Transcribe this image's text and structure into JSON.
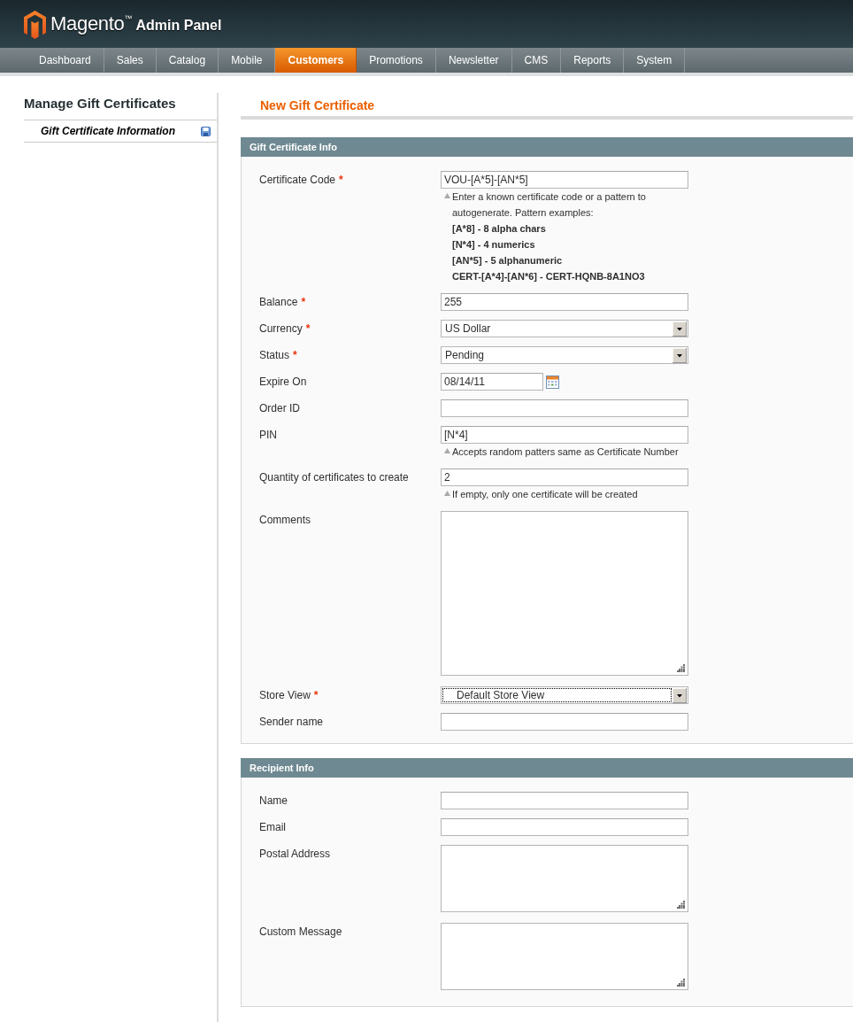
{
  "header": {
    "logo_text": "Magento$^{™}$",
    "logo_subtitle": "Admin Panel"
  },
  "nav": {
    "tabs": [
      {
        "label": "Dashboard",
        "selected": false
      },
      {
        "label": "Sales",
        "selected": false
      },
      {
        "label": "Catalog",
        "selected": false
      },
      {
        "label": "Mobile",
        "selected": false
      },
      {
        "label": "Customers",
        "selected": true
      },
      {
        "label": "Promotions",
        "selected": false
      },
      {
        "label": "Newsletter",
        "selected": false
      },
      {
        "label": "CMS",
        "selected": false
      },
      {
        "label": "Reports",
        "selected": false
      },
      {
        "label": "System",
        "selected": false
      }
    ]
  },
  "sidebar": {
    "title": "Manage Gift Certificates",
    "items": [
      {
        "label": "Gift Certificate Information",
        "selected": true
      }
    ]
  },
  "page_title": "New Gift Certificate",
  "sections": [
    {
      "title": "Gift Certificate Info",
      "fields": [
        {
          "label": "Certificate Code",
          "required_mark": "*",
          "kind": "text",
          "value": "VOU-[A*5]-[AN*5]",
          "focused": false,
          "note": {
            "text": "Enter a known certificate code or a pattern to autogenerate. Pattern examples:",
            "examples": [
              "[A*8] - 8 alpha chars",
              "[N*4] - 4 numerics",
              "[AN*5] - 5 alphanumeric",
              "CERT-[A*4]-[AN*6] - CERT-HQNB-8A1NO3"
            ]
          }
        },
        {
          "label": "Balance",
          "required_mark": "*",
          "kind": "text",
          "value": "255",
          "focused": false
        },
        {
          "label": "Currency",
          "required_mark": "*",
          "kind": "select",
          "value": "US Dollar",
          "indented": false,
          "focused": false
        },
        {
          "label": "Status",
          "required_mark": "*",
          "kind": "select",
          "value": "Pending",
          "indented": false,
          "focused": false
        },
        {
          "label": "Expire On",
          "kind": "date",
          "value": "08/14/11",
          "focused": false
        },
        {
          "label": "Order ID",
          "kind": "text",
          "focused": false
        },
        {
          "label": "PIN",
          "kind": "text",
          "value": "[N*4]",
          "focused": false,
          "note": {
            "text": "Accepts random patters same as Certificate Number"
          }
        },
        {
          "label": "Quantity of certificates to create",
          "kind": "text",
          "value": "2",
          "focused": false,
          "note": {
            "text": "If empty, only one certificate will be created"
          }
        },
        {
          "label": "Comments",
          "kind": "textarea",
          "focused": false
        },
        {
          "label": "Store View",
          "required_mark": "*",
          "kind": "select",
          "value": "Default Store View",
          "indented": true,
          "focused": true
        },
        {
          "label": "Sender name",
          "kind": "text",
          "focused": false
        }
      ]
    },
    {
      "title": "Recipient Info",
      "fields": [
        {
          "label": "Name",
          "kind": "text",
          "focused": false
        },
        {
          "label": "Email",
          "kind": "text",
          "focused": false
        },
        {
          "label": "Postal Address",
          "kind": "textarea",
          "focused": false
        },
        {
          "label": "Custom Message",
          "kind": "textarea",
          "focused": false
        }
      ]
    }
  ]
}
